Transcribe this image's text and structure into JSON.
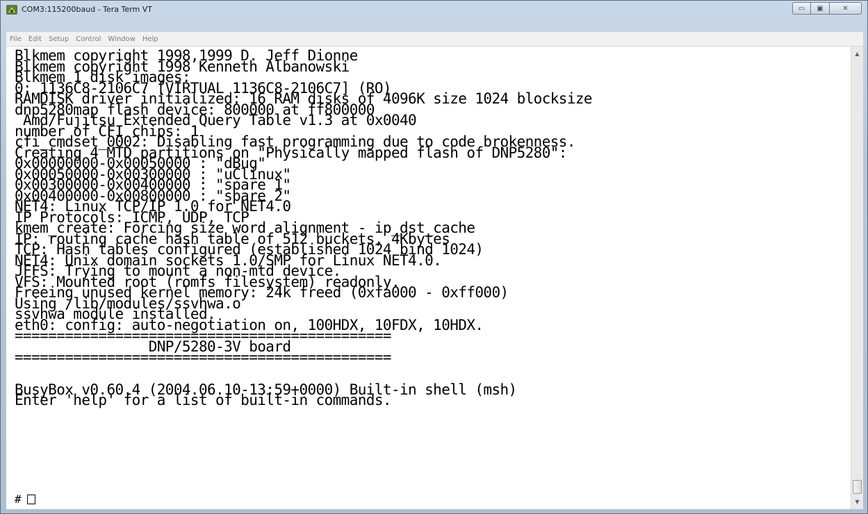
{
  "window": {
    "title": "COM3:115200baud - Tera Term VT",
    "controls": {
      "minimize_icon": "minimize-icon",
      "maximize_icon": "maximize-icon",
      "close_icon": "close-icon"
    },
    "minimize_glyph": "▭",
    "maximize_glyph": "▣",
    "close_glyph": "✕"
  },
  "menu": {
    "items": [
      "File",
      "Edit",
      "Setup",
      "Control",
      "Window",
      "Help"
    ]
  },
  "terminal": {
    "lines": [
      "Blkmem copyright 1998,1999 D. Jeff Dionne",
      "Blkmem copyright 1998 Kenneth Albanowski",
      "Blkmem 1 disk images:",
      "0: 1136C8-2106C7 [VIRTUAL 1136C8-2106C7] (RO)",
      "RAMDISK driver initialized: 16 RAM disks of 4096K size 1024 blocksize",
      "dnp5280map flash device: 800000 at ff800000",
      " Amd/Fujitsu Extended Query Table v1.3 at 0x0040",
      "number of CFI chips: 1",
      "cfi_cmdset_0002: Disabling fast programming due to code brokenness.",
      "Creating 4 MTD partitions on \"Physically mapped flash of DNP5280\":",
      "0x00000000-0x00050000 : \"dBug\"",
      "0x00050000-0x00300000 : \"uClinux\"",
      "0x00300000-0x00400000 : \"spare 1\"",
      "0x00400000-0x00800000 : \"spare 2\"",
      "NET4: Linux TCP/IP 1.0 for NET4.0",
      "IP Protocols: ICMP, UDP, TCP",
      "kmem_create: Forcing size word alignment - ip_dst_cache",
      "IP: routing cache hash table of 512 buckets, 4Kbytes",
      "TCP: Hash tables configured (established 1024 bind 1024)",
      "NET4: Unix domain sockets 1.0/SMP for Linux NET4.0.",
      "JFFS: Trying to mount a non-mtd device.",
      "VFS: Mounted root (romfs filesystem) readonly.",
      "Freeing unused kernel memory: 24k freed (0xfa000 - 0xff000)",
      "Using /lib/modules/ssvhwa.o",
      "ssvhwa module installed.",
      "eth0: config: auto-negotiation on, 100HDX, 10FDX, 10HDX.",
      "=============================================",
      "                DNP/5280-3V board",
      "=============================================",
      "",
      "",
      "BusyBox v0.60.4 (2004.06.10-13:59+0000) Built-in shell (msh)",
      "Enter 'help' for a list of built-in commands.",
      ""
    ],
    "prompt": "#"
  },
  "scrollbar": {
    "up_glyph": "▲",
    "down_glyph": "▼"
  }
}
